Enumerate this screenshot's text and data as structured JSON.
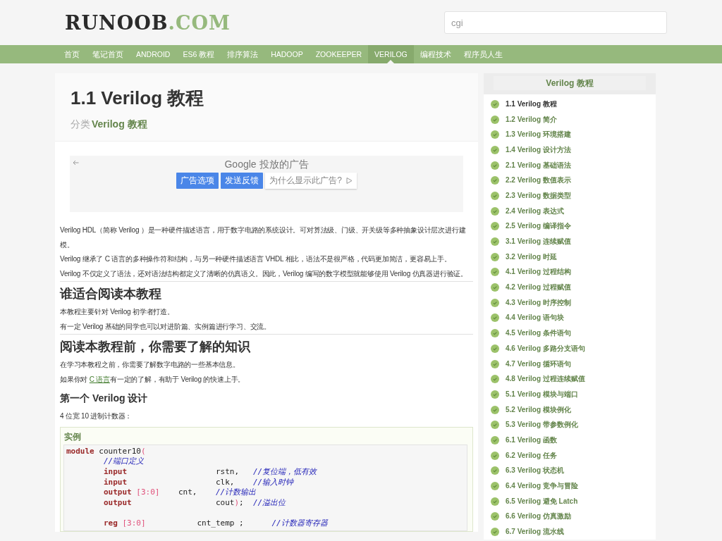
{
  "header": {
    "logo": {
      "main": "RUNOOB",
      "suffix": ".COM"
    },
    "search": {
      "value": "cgi"
    }
  },
  "nav": [
    {
      "label": "首页",
      "selected": false
    },
    {
      "label": "笔记首页",
      "selected": false
    },
    {
      "label": "ANDROID",
      "selected": false
    },
    {
      "label": "ES6 教程",
      "selected": false
    },
    {
      "label": "排序算法",
      "selected": false
    },
    {
      "label": "HADOOP",
      "selected": false
    },
    {
      "label": "ZOOKEEPER",
      "selected": false
    },
    {
      "label": "VERILOG",
      "selected": true
    },
    {
      "label": "编程技术",
      "selected": false
    },
    {
      "label": "程序员人生",
      "selected": false
    }
  ],
  "article": {
    "title": "1.1 Verilog 教程",
    "category": {
      "label": "分类",
      "link": "Verilog 教程"
    },
    "ad": {
      "title": "Google 投放的广告",
      "buttons": [
        "广告选项",
        "发送反馈"
      ],
      "why": "为什么显示此广告?"
    },
    "blocks": [
      {
        "kind": "p",
        "text": "Verilog HDL（简称 Verilog ）是一种硬件描述语言，用于数字电路的系统设计。可对算法级、门级、开关级等多种抽象设计层次进行建模。"
      },
      {
        "kind": "p",
        "text": "Verilog 继承了 C 语言的多种操作符和结构，与另一种硬件描述语言 VHDL 相比，语法不是很严格，代码更加简洁，更容易上手。"
      },
      {
        "kind": "p",
        "text": "Verilog 不仅定义了语法，还对语法结构都定义了清晰的仿真语义。因此，Verilog 编写的数字模型就能够使用 Verilog 仿真器进行验证。"
      },
      {
        "kind": "h2",
        "text": "谁适合阅读本教程"
      },
      {
        "kind": "p",
        "text": "本教程主要针对 Verilog 初学者打造。"
      },
      {
        "kind": "p",
        "text": "有一定 Verilog 基础的同学也可以对进阶篇、实例篇进行学习、交流。"
      },
      {
        "kind": "h2",
        "text": "阅读本教程前，你需要了解的知识"
      },
      {
        "kind": "p",
        "text": "在学习本教程之前，你需要了解数字电路的一些基本信息。"
      },
      {
        "kind": "plink",
        "before": "如果你对 ",
        "link": "C 语言",
        "after": "有一定的了解，有助于 Verilog 的快速上手。"
      },
      {
        "kind": "h3",
        "text": "第一个 Verilog 设计"
      },
      {
        "kind": "p",
        "text": "4 位宽 10 进制计数器："
      }
    ],
    "example": {
      "label": "实例",
      "lines": [
        {
          "kind": "code",
          "tokens": [
            {
              "kind": "kw",
              "text": "module"
            },
            {
              "kind": "plain",
              "text": " counter10"
            },
            {
              "kind": "punct",
              "text": "("
            }
          ]
        },
        {
          "kind": "code",
          "tokens": [
            {
              "kind": "comment",
              "text": "        //端口定义"
            }
          ]
        },
        {
          "kind": "code",
          "tokens": [
            {
              "kind": "kw",
              "text": "        input"
            },
            {
              "kind": "plain",
              "text": "                   rstn,   "
            },
            {
              "kind": "comment",
              "text": "//复位端，低有效"
            }
          ]
        },
        {
          "kind": "code",
          "tokens": [
            {
              "kind": "kw",
              "text": "        input"
            },
            {
              "kind": "plain",
              "text": "                   clk,    "
            },
            {
              "kind": "comment",
              "text": "//输入时钟"
            }
          ]
        },
        {
          "kind": "code",
          "tokens": [
            {
              "kind": "kw",
              "text": "        output"
            },
            {
              "kind": "num",
              "text": " [3:0]"
            },
            {
              "kind": "plain",
              "text": "    cnt,    "
            },
            {
              "kind": "comment",
              "text": "//计数输出"
            }
          ]
        },
        {
          "kind": "code",
          "tokens": [
            {
              "kind": "kw",
              "text": "        output"
            },
            {
              "kind": "plain",
              "text": "                  cout"
            },
            {
              "kind": "punct",
              "text": ")"
            },
            {
              "kind": "plain",
              "text": ";  "
            },
            {
              "kind": "comment",
              "text": "//溢出位"
            }
          ]
        },
        {
          "kind": "blank"
        },
        {
          "kind": "code",
          "tokens": [
            {
              "kind": "kw",
              "text": "        reg"
            },
            {
              "kind": "num",
              "text": " [3:0]"
            },
            {
              "kind": "plain",
              "text": "           cnt_temp ;      "
            },
            {
              "kind": "comment",
              "text": "//计数器寄存器"
            }
          ]
        }
      ]
    }
  },
  "sidebar": {
    "title": "Verilog 教程",
    "items": [
      {
        "label": "1.1 Verilog 教程",
        "selected": true
      },
      {
        "label": "1.2 Verilog 简介",
        "selected": false
      },
      {
        "label": "1.3 Verilog 环境搭建",
        "selected": false
      },
      {
        "label": "1.4 Verilog 设计方法",
        "selected": false
      },
      {
        "label": "2.1 Verilog 基础语法",
        "selected": false
      },
      {
        "label": "2.2 Verilog 数值表示",
        "selected": false
      },
      {
        "label": "2.3 Verilog 数据类型",
        "selected": false
      },
      {
        "label": "2.4 Verilog 表达式",
        "selected": false
      },
      {
        "label": "2.5 Verilog 编译指令",
        "selected": false
      },
      {
        "label": "3.1 Verilog 连续赋值",
        "selected": false
      },
      {
        "label": "3.2 Verilog 时延",
        "selected": false
      },
      {
        "label": "4.1 Verilog 过程结构",
        "selected": false
      },
      {
        "label": "4.2 Verilog 过程赋值",
        "selected": false
      },
      {
        "label": "4.3 Verilog 时序控制",
        "selected": false
      },
      {
        "label": "4.4 Verilog 语句块",
        "selected": false
      },
      {
        "label": "4.5 Verilog 条件语句",
        "selected": false
      },
      {
        "label": "4.6 Verilog 多路分支语句",
        "selected": false
      },
      {
        "label": "4.7 Verilog 循环语句",
        "selected": false
      },
      {
        "label": "4.8 Verilog 过程连续赋值",
        "selected": false
      },
      {
        "label": "5.1 Verilog 模块与端口",
        "selected": false
      },
      {
        "label": "5.2 Verilog 模块例化",
        "selected": false
      },
      {
        "label": "5.3 Verilog 带参数例化",
        "selected": false
      },
      {
        "label": "6.1 Verilog 函数",
        "selected": false
      },
      {
        "label": "6.2 Verilog 任务",
        "selected": false
      },
      {
        "label": "6.3 Verilog 状态机",
        "selected": false
      },
      {
        "label": "6.4 Verilog 竞争与冒险",
        "selected": false
      },
      {
        "label": "6.5 Verilog 避免 Latch",
        "selected": false
      },
      {
        "label": "6.6 Verilog 仿真激励",
        "selected": false
      },
      {
        "label": "6.7 Verilog 流水线",
        "selected": false
      }
    ]
  }
}
